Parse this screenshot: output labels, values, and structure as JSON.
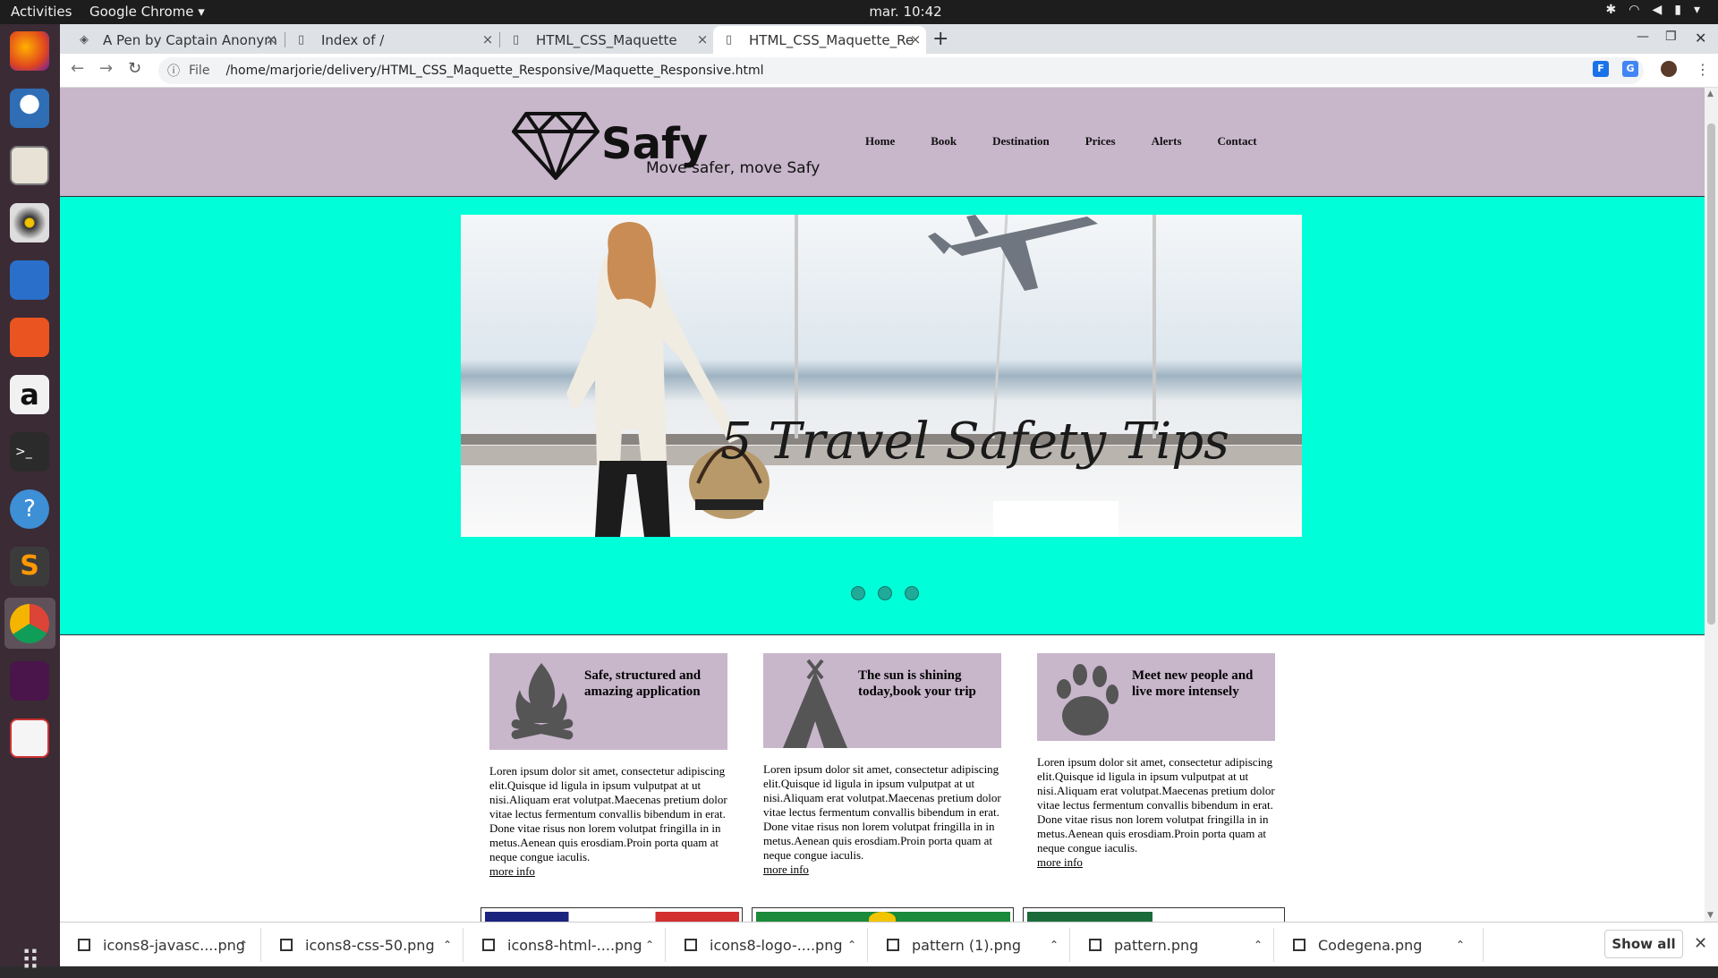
{
  "topbar": {
    "activities": "Activities",
    "app_name": "Google Chrome ▾",
    "clock": "mar. 10:42"
  },
  "tabs": [
    {
      "title": "A Pen by Captain Anonym"
    },
    {
      "title": "Index of /"
    },
    {
      "title": "HTML_CSS_Maquette"
    },
    {
      "title": "HTML_CSS_Maquette_Re"
    }
  ],
  "toolbar": {
    "scheme": "File",
    "url": "/home/marjorie/delivery/HTML_CSS_Maquette_Responsive/Maquette_Responsive.html"
  },
  "site": {
    "brand": "Safy",
    "tagline": "Move safer, move Safy",
    "menu": [
      "Home",
      "Book",
      "Destination",
      "Prices",
      "Alerts",
      "Contact"
    ],
    "banner_caption": "5 Travel Safety Tips",
    "slider_dots": 3,
    "features": [
      {
        "title": "Safe, structured and amazing application",
        "icon": "campfire-icon",
        "body": "Loren ipsum dolor sit amet, consectetur adipiscing elit.Quisque id ligula in ipsum vulputpat at ut nisi.Aliquam erat volutpat.Maecenas pretium dolor vitae lectus fermentum convallis bibendum in erat. Done vitae risus non lorem volutpat fringilla in in metus.Aenean quis erosdiam.Proin porta quam at neque congue iaculis.",
        "more": "more info"
      },
      {
        "title": "The sun is shining today,book your trip",
        "icon": "tent-icon",
        "body": "Loren ipsum dolor sit amet, consectetur adipiscing elit.Quisque id ligula in ipsum vulputpat at ut nisi.Aliquam erat volutpat.Maecenas pretium dolor vitae lectus fermentum convallis bibendum in erat. Done vitae risus non lorem volutpat fringilla in in metus.Aenean quis erosdiam.Proin porta quam at neque congue iaculis.",
        "more": "more info"
      },
      {
        "title": "Meet new people and live more intensely",
        "icon": "paw-icon",
        "body": "Loren ipsum dolor sit amet, consectetur adipiscing elit.Quisque id ligula in ipsum vulputpat at ut nisi.Aliquam erat volutpat.Maecenas pretium dolor vitae lectus fermentum convallis bibendum in erat. Done vitae risus non lorem volutpat fringilla in in metus.Aenean quis erosdiam.Proin porta quam at neque congue iaculis.",
        "more": "more info"
      }
    ]
  },
  "downloads": [
    {
      "name": "icons8-javasc....png"
    },
    {
      "name": "icons8-css-50.png"
    },
    {
      "name": "icons8-html-....png"
    },
    {
      "name": "icons8-logo-....png"
    },
    {
      "name": "pattern (1).png"
    },
    {
      "name": "pattern.png"
    },
    {
      "name": "Codegena.png"
    }
  ],
  "downloads_show_all": "Show all",
  "colors": {
    "header": "#c8b6cb",
    "hero": "#00ffd9",
    "dock": "#3b2b35"
  }
}
